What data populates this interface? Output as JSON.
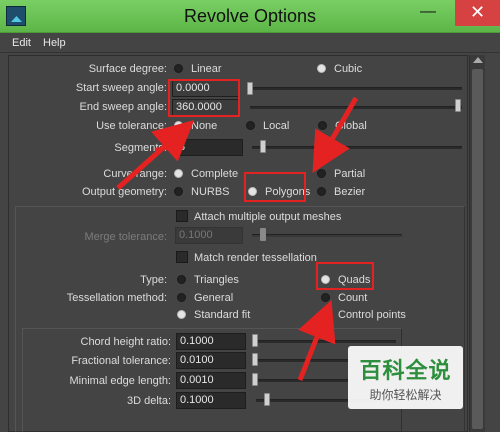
{
  "window": {
    "title": "Revolve Options",
    "minimize_glyph": "—",
    "close_glyph": "✕"
  },
  "menu": {
    "items": [
      "Edit",
      "Help"
    ]
  },
  "surface_degree": {
    "label": "Surface degree:",
    "options": [
      "Linear",
      "Cubic"
    ],
    "selected": "Cubic"
  },
  "start_sweep": {
    "label": "Start sweep angle:",
    "value": "0.0000"
  },
  "end_sweep": {
    "label": "End sweep angle:",
    "value": "360.0000"
  },
  "use_tolerance": {
    "label": "Use tolerance:",
    "options": [
      "None",
      "Local",
      "Global"
    ],
    "selected": "None"
  },
  "segments": {
    "label": "Segments:",
    "value": "8"
  },
  "curve_range": {
    "label": "Curve range:",
    "options": [
      "Complete",
      "Partial"
    ],
    "selected": "Complete"
  },
  "output_geometry": {
    "label": "Output geometry:",
    "options": [
      "NURBS",
      "Polygons",
      "Bezier"
    ],
    "selected": "Polygons"
  },
  "attach_multiple": {
    "label": "Attach multiple output meshes"
  },
  "merge_tolerance": {
    "label": "Merge tolerance:",
    "value": "0.1000"
  },
  "match_render": {
    "label": "Match render tessellation"
  },
  "type": {
    "label": "Type:",
    "options": [
      "Triangles",
      "Quads"
    ],
    "selected": "Quads"
  },
  "tessellation_method": {
    "label": "Tessellation method:",
    "options": [
      "General",
      "Count",
      "Standard fit",
      "Control points"
    ],
    "selected": "Standard fit"
  },
  "chord_height": {
    "label": "Chord height ratio:",
    "value": "0.1000"
  },
  "fractional_tolerance": {
    "label": "Fractional tolerance:",
    "value": "0.0100"
  },
  "minimal_edge": {
    "label": "Minimal edge length:",
    "value": "0.0010"
  },
  "delta_3d": {
    "label": "3D delta:",
    "value": "0.1000"
  },
  "watermark": {
    "title": "百科全说",
    "subtitle": "助你轻松解决"
  },
  "colors": {
    "titlebar": "#6cc756",
    "highlight": "#e42222",
    "panel": "#444444",
    "close": "#d64141"
  }
}
